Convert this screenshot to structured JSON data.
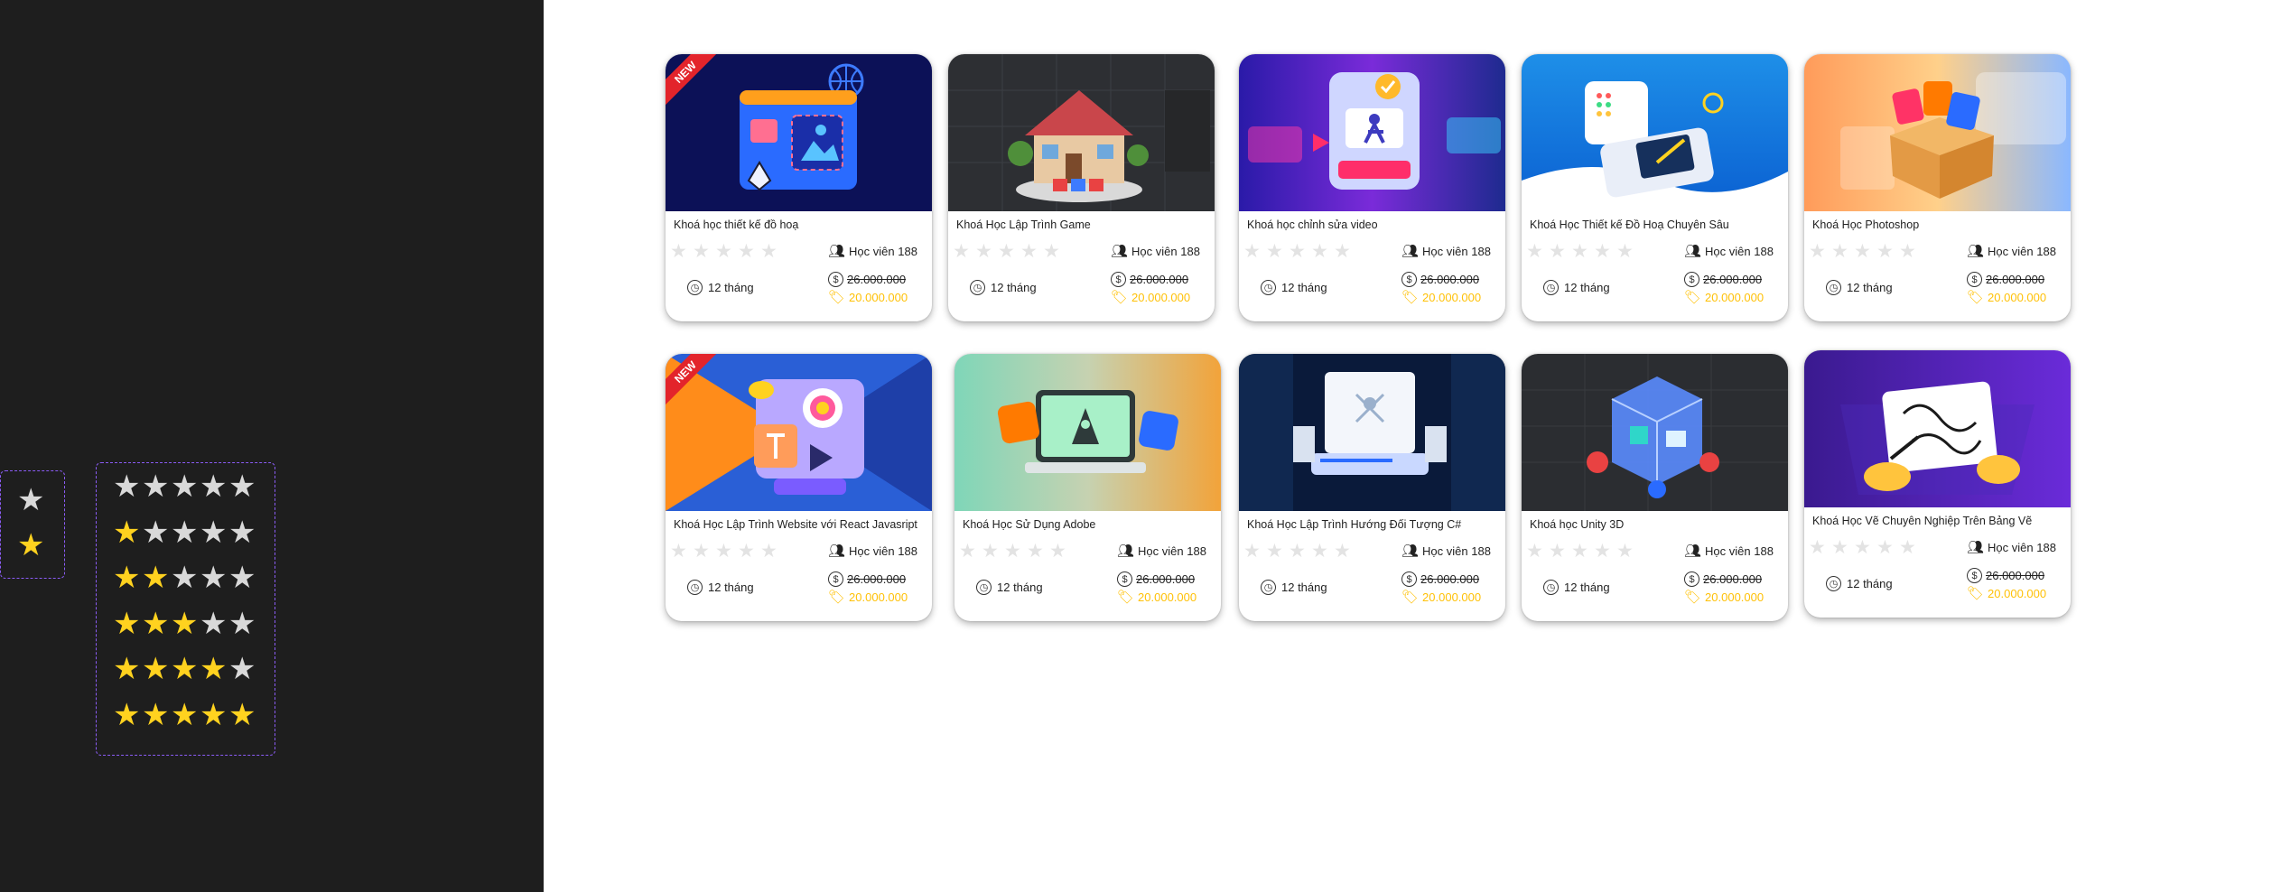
{
  "rating_legend": {
    "single": [
      {
        "state": "empty",
        "color": "#d9d9d9"
      },
      {
        "state": "filled",
        "color": "#ffd21f"
      }
    ],
    "rows": [
      0,
      1,
      2,
      3,
      4,
      5
    ],
    "max": 5
  },
  "courses": [
    {
      "title": "Khoá học thiết kế đồ hoạ",
      "students": "Học viên 188",
      "duration": "12 tháng",
      "old_price": "26.000.000",
      "new_price": "20.000.000",
      "rating": 0,
      "badge": "NEW",
      "thumb": "graphic-design"
    },
    {
      "title": "Khoá Học Lập Trình Game",
      "students": "Học viên 188",
      "duration": "12 tháng",
      "old_price": "26.000.000",
      "new_price": "20.000.000",
      "rating": 0,
      "badge": "",
      "thumb": "game-house"
    },
    {
      "title": "Khoá học chỉnh sửa video",
      "students": "Học viên 188",
      "duration": "12 tháng",
      "old_price": "26.000.000",
      "new_price": "20.000.000",
      "rating": 0,
      "badge": "",
      "thumb": "video-editing"
    },
    {
      "title": "Khoá Học Thiết kế Đồ Hoạ Chuyên Sâu",
      "students": "Học viên 188",
      "duration": "12 tháng",
      "old_price": "26.000.000",
      "new_price": "20.000.000",
      "rating": 0,
      "badge": "",
      "thumb": "design-tablet"
    },
    {
      "title": "Khoá Học Photoshop",
      "students": "Học viên 188",
      "duration": "12 tháng",
      "old_price": "26.000.000",
      "new_price": "20.000.000",
      "rating": 0,
      "badge": "",
      "thumb": "photoshop-box"
    },
    {
      "title": "Khoá Học Lập Trình Website với React Javasript",
      "students": "Học viên 188",
      "duration": "12 tháng",
      "old_price": "26.000.000",
      "new_price": "20.000.000",
      "rating": 0,
      "badge": "NEW",
      "thumb": "react-web"
    },
    {
      "title": "Khoá Học Sử Dụng Adobe",
      "students": "Học viên 188",
      "duration": "12 tháng",
      "old_price": "26.000.000",
      "new_price": "20.000.000",
      "rating": 0,
      "badge": "",
      "thumb": "adobe-laptop"
    },
    {
      "title": "Khoá Học Lập Trình Hướng Đối Tượng C#",
      "students": "Học viên 188",
      "duration": "12 tháng",
      "old_price": "26.000.000",
      "new_price": "20.000.000",
      "rating": 0,
      "badge": "",
      "thumb": "csharp-oop"
    },
    {
      "title": "Khoá học Unity 3D",
      "students": "Học viên 188",
      "duration": "12 tháng",
      "old_price": "26.000.000",
      "new_price": "20.000.000",
      "rating": 0,
      "badge": "",
      "thumb": "unity-3d"
    },
    {
      "title": "Khoá Học Vẽ Chuyên Nghiệp Trên Bảng Vẽ",
      "students": "Học viên 188",
      "duration": "12 tháng",
      "old_price": "26.000.000",
      "new_price": "20.000.000",
      "rating": 0,
      "badge": "",
      "thumb": "digital-painting"
    }
  ],
  "icons": {
    "students": "users-icon",
    "duration": "clock-icon",
    "price": "dollar-circle-icon",
    "sale": "price-tag-icon",
    "star": "star-icon"
  },
  "colors": {
    "panel_dark": "#1e1e1e",
    "legend_border": "#8b5cf6",
    "star_gold": "#ffd21f",
    "star_gray": "#d9d9d9",
    "sale_price": "#ffc107",
    "badge": "#e3242b"
  }
}
